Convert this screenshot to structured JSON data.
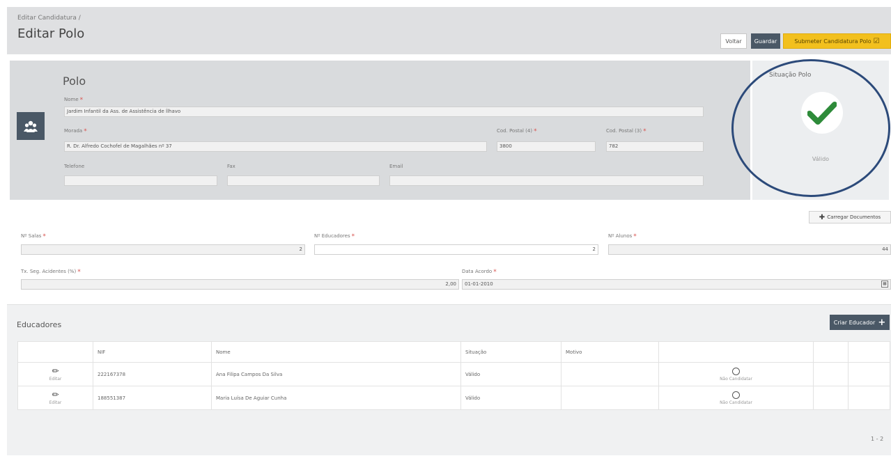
{
  "header": {
    "breadcrumb": "Editar Candidatura /",
    "title": "Editar Polo",
    "voltar_label": "Voltar",
    "guardar_label": "Guardar",
    "submeter_label": "Submeter Candidatura Polo"
  },
  "polo": {
    "title": "Polo",
    "nome_label": "Nome",
    "nome_value": "Jardim Infantil da Ass. de Assistência de Ílhavo",
    "morada_label": "Morada",
    "morada_value": "R. Dr. Alfredo Cochofel de Magalhães nº 37",
    "cod_postal4_label": "Cod. Postal (4)",
    "cod_postal4_value": "3800",
    "cod_postal3_label": "Cod. Postal (3)",
    "cod_postal3_value": "782",
    "telefone_label": "Telefone",
    "fax_label": "Fax",
    "email_label": "Email"
  },
  "situacao": {
    "title": "Situação Polo",
    "value": "Válido"
  },
  "details": {
    "carregar_label": "Carregar Documentos",
    "salas_label": "Nº Salas",
    "salas_value": "2",
    "educadores_label": "Nº Educadores",
    "educadores_value": "2",
    "alunos_label": "Nº Alunos",
    "alunos_value": "44",
    "taxa_label": "Tx. Seg. Acidentes (%)",
    "taxa_value": "2,00",
    "data_label": "Data Acordo",
    "data_value": "01-01-2010"
  },
  "educadores": {
    "title": "Educadores",
    "criar_label": "Criar Educador",
    "columns": [
      "NIF",
      "Nome",
      "Situação",
      "Motivo"
    ],
    "edit_label": "Editar",
    "nao_candidatar_label": "Não Candidatar",
    "rows": [
      {
        "nif": "222167378",
        "nome": "Ana Filipa Campos Da Silva",
        "situacao": "Válido",
        "motivo": ""
      },
      {
        "nif": "188551387",
        "nome": "Maria Luísa De Aguiar Cunha",
        "situacao": "Válido",
        "motivo": ""
      }
    ],
    "pager": "1 - 2"
  },
  "colors": {
    "accent_dark": "#4a5866",
    "submit_yellow": "#f2c01e",
    "check_green": "#2e8b3a",
    "highlight_ring": "#2c4a7a"
  },
  "icons": {
    "polo": "group-icon",
    "situacao": "check-icon",
    "edit": "pencil-icon",
    "nao_candidatar": "circle-icon",
    "calendar": "calendar-icon"
  }
}
